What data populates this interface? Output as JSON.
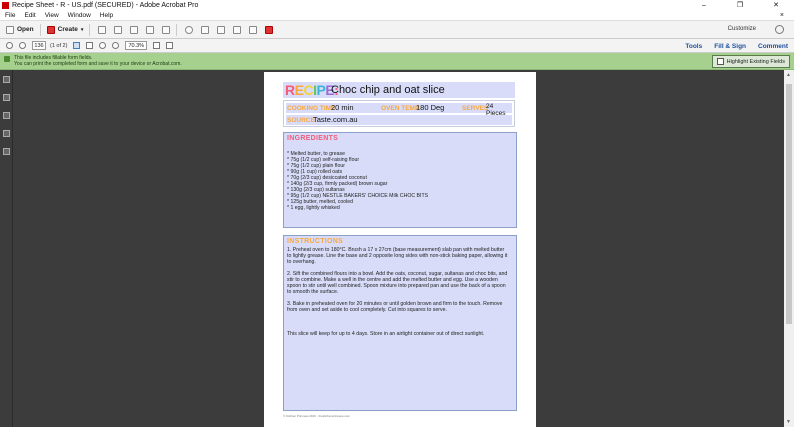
{
  "window": {
    "title": "Recipe Sheet - R - US.pdf (SECURED) - Adobe Acrobat Pro",
    "controls": [
      "–",
      "❐",
      "✕"
    ]
  },
  "menu": {
    "items": [
      "File",
      "Edit",
      "View",
      "Window",
      "Help"
    ],
    "close": "×"
  },
  "toolbar": {
    "open": "Open",
    "create": "Create",
    "customize": "Customize"
  },
  "nav": {
    "page": "136",
    "of": "(1 of 2)",
    "zoom": "70.3%",
    "tools": "Tools",
    "fill_sign": "Fill & Sign",
    "comment": "Comment"
  },
  "info": {
    "line1": "This file includes fillable form fields.",
    "line2": "You can print the completed form and save it to your device or Acrobat.com.",
    "highlight": "Highlight Existing Fields"
  },
  "recipe": {
    "label_letters": [
      "R",
      "E",
      "C",
      "I",
      "P",
      "E",
      ":"
    ],
    "title": "Choc chip and oat slice",
    "cooking_time_label": "COOKING TIME",
    "cooking_time": "20 min",
    "oven_temp_label": "OVEN TEMP",
    "oven_temp": "180 Deg",
    "serves_label": "SERVES",
    "serves": "24 Pieces",
    "source_label": "SOURCE",
    "source": "Taste.com.au",
    "ingredients_label": "INGREDIENTS",
    "ingredients": [
      "* Melted butter, to grease",
      "* 75g (1/2 cup) self-raising flour",
      "* 75g (1/2 cup) plain flour",
      "* 90g (1 cup) rolled oats",
      "* 70g (2/3 cup) desiccated coconut",
      "* 140g (2/3 cup, firmly packed) brown sugar",
      "* 130g (2/3 cup) sultanas",
      "* 95g (1/2 cup) NESTLE BAKERS' CHOICE Milk CHOC BITS",
      "* 125g butter, melted, cooled",
      "* 1 egg, lightly whisked"
    ],
    "instructions_label": "INSTRUCTIONS",
    "instructions": [
      "1. Preheat oven to 180°C. Brush a 17 x 27cm (base measurement) slab pan with melted butter",
      "to lightly grease. Line the base and 2 opposite long sides with non-stick baking paper, allowing it",
      "to overhang.",
      "",
      "2. Sift the combined flours into a bowl. Add the oats, coconut, sugar, sultanas and choc bits, and",
      "stir to combine. Make a well in the centre and add the melted butter and egg. Use a wooden",
      "spoon to stir until well combined. Spoon mixture into prepared pan and use the back of a spoon",
      "to smooth the surface.",
      "",
      "3. Bake in preheated oven for 20 minutes or until golden brown and firm to the touch. Remove",
      "from oven and set aside to cool completely. Cut into squares to serve.",
      "",
      "",
      "This slice will keep for up to 4 days. Store in an airtight container out of direct sunlight."
    ],
    "footer": "© Kitchen Princess 2016 · thekitchenprincess.com"
  }
}
